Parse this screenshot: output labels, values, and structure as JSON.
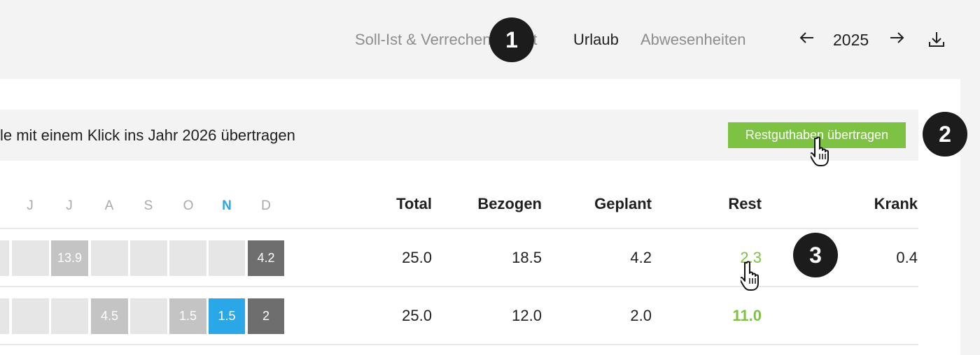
{
  "header": {
    "tabs": [
      {
        "label": "Soll-Ist & Verrechenbarkeit",
        "active": false
      },
      {
        "label": "Urlaub",
        "active": true
      },
      {
        "label": "Abwesenheiten",
        "active": false
      }
    ],
    "year": "2025",
    "prev_icon": "arrow-left-icon",
    "next_icon": "arrow-right-icon",
    "download_icon": "download-icon"
  },
  "markers": [
    "1",
    "2",
    "3"
  ],
  "banner": {
    "text": "le mit einem Klick ins Jahr 2026 übertragen",
    "button_label": "Restguthaben übertragen",
    "button_color": "#7dc242"
  },
  "table": {
    "months": [
      "J",
      "J",
      "A",
      "S",
      "O",
      "N",
      "D"
    ],
    "current_month_index": 5,
    "columns": [
      "Total",
      "Bezogen",
      "Geplant",
      "Rest",
      "Krank"
    ],
    "rows": [
      {
        "cells": [
          "",
          "",
          "13.9",
          "",
          "",
          "",
          "",
          "4.2"
        ],
        "values": [
          "25.0",
          "18.5",
          "4.2",
          "2.3",
          "0.4"
        ]
      },
      {
        "cells": [
          "",
          "",
          "",
          "4.5",
          "",
          "1.5",
          "1.5",
          "2"
        ],
        "values": [
          "25.0",
          "12.0",
          "2.0",
          "11.0",
          ""
        ]
      }
    ]
  },
  "colors": {
    "accent_green": "#7dc242",
    "accent_blue": "#2aa7e6"
  }
}
